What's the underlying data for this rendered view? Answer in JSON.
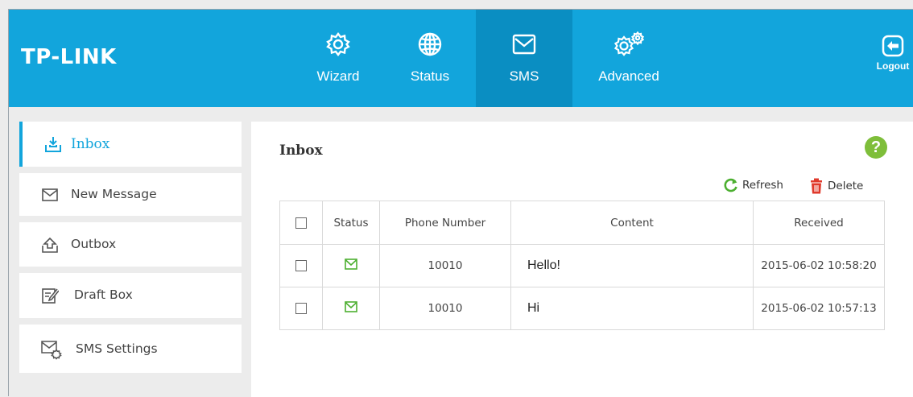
{
  "brand": {
    "logo": "TP-LINK"
  },
  "nav": {
    "items": [
      {
        "label": "Wizard",
        "icon": "gear-icon"
      },
      {
        "label": "Status",
        "icon": "globe-icon"
      },
      {
        "label": "SMS",
        "icon": "envelope-icon",
        "active": true
      },
      {
        "label": "Advanced",
        "icon": "gears-icon"
      }
    ],
    "logout": "Logout"
  },
  "sidebar": {
    "items": [
      {
        "label": "Inbox",
        "icon": "inbox-icon",
        "active": true
      },
      {
        "label": "New Message",
        "icon": "envelope-icon"
      },
      {
        "label": "Outbox",
        "icon": "outbox-icon"
      },
      {
        "label": "Draft Box",
        "icon": "draft-icon"
      },
      {
        "label": "SMS Settings",
        "icon": "sms-settings-icon"
      }
    ]
  },
  "main": {
    "title": "Inbox",
    "help": "?",
    "toolbar": {
      "refresh": "Refresh",
      "delete": "Delete"
    },
    "table": {
      "headers": [
        "",
        "Status",
        "Phone Number",
        "Content",
        "Received"
      ],
      "rows": [
        {
          "status": "unread-envelope-icon",
          "phone": "10010",
          "content": "Hello!",
          "received": "2015-06-02 10:58:20"
        },
        {
          "status": "unread-envelope-icon",
          "phone": "10010",
          "content": "Hi",
          "received": "2015-06-02 10:57:13"
        }
      ]
    }
  },
  "colors": {
    "header": "#12a5dc",
    "header_active": "#0a8ec2",
    "accent": "#12a5dc",
    "status_green": "#7ebe3a",
    "delete_red": "#e0392b"
  }
}
